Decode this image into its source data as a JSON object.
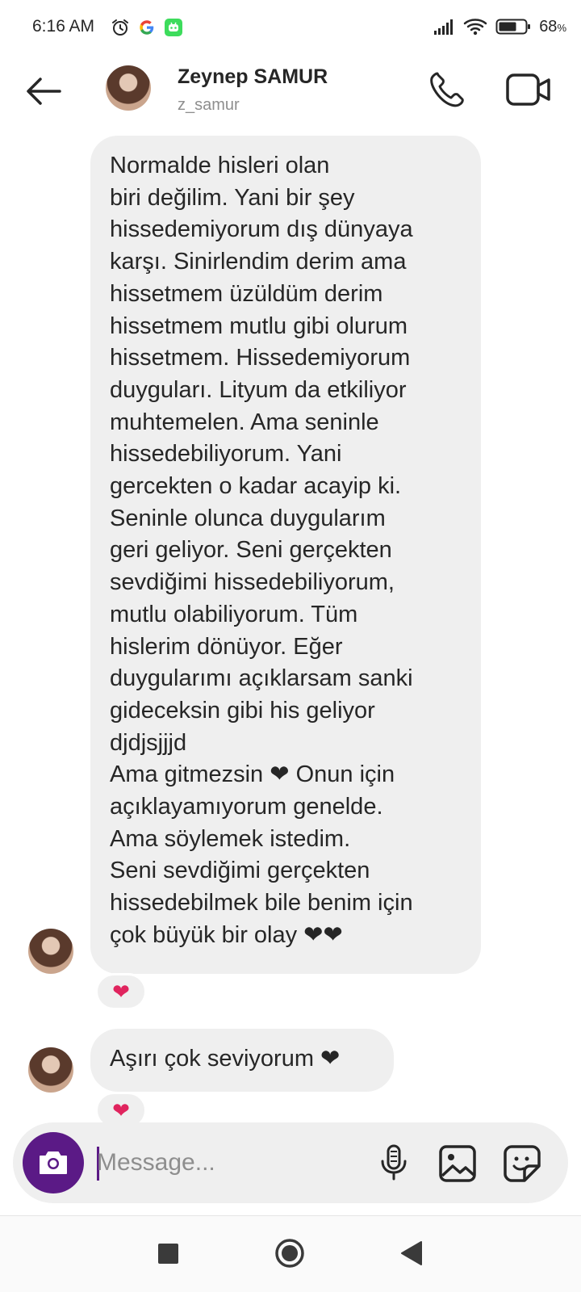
{
  "status_bar": {
    "time": "6:16 AM",
    "battery_value": "68",
    "battery_unit": "%",
    "icons": [
      "alarm-icon",
      "google-icon",
      "app-notification-icon",
      "signal-icon",
      "wifi-icon",
      "battery-icon"
    ]
  },
  "header": {
    "name": "Zeynep SAMUR",
    "username": "z_samur",
    "icons": [
      "back-arrow-icon",
      "phone-icon",
      "video-camera-icon"
    ]
  },
  "messages": [
    {
      "text": "Normalde hisleri olan\nbiri değilim. Yani bir şey\nhissedemiyorum dış dünyaya\nkarşı. Sinirlendim derim ama\nhissetmem üzüldüm derim\nhissetmem mutlu gibi olurum\nhissetmem.  Hissedemiyorum\nduyguları. Lityum da etkiliyor\nmuhtemelen.  Ama seninle\nhissedebiliyorum. Yani\ngercekten o kadar acayip ki.\nSeninle olunca duygularım\ngeri geliyor. Seni gerçekten\nsevdiğimi hissedebiliyorum,\nmutlu olabiliyorum. Tüm\nhislerim dönüyor. Eğer\nduygularımı açıklarsam sanki\ngideceksin gibi his geliyor\ndjdjsjjjd\nAma gitmezsin ❤ Onun için\naçıklayamıyorum genelde.\nAma söylemek istedim.\nSeni sevdiğimi gerçekten\nhissedebilmek bile benim için\nçok büyük bir olay ❤❤",
      "reaction": "❤"
    },
    {
      "text": "Aşırı çok seviyorum ❤",
      "reaction": "❤"
    }
  ],
  "composer": {
    "placeholder": "Message...",
    "icons": [
      "camera-icon",
      "microphone-icon",
      "gallery-icon",
      "sticker-icon"
    ]
  },
  "colors": {
    "bubble": "#efefef",
    "camera_button": "#5b1a86",
    "heart": "#e0245e",
    "secondary_text": "#8e8e8e"
  }
}
